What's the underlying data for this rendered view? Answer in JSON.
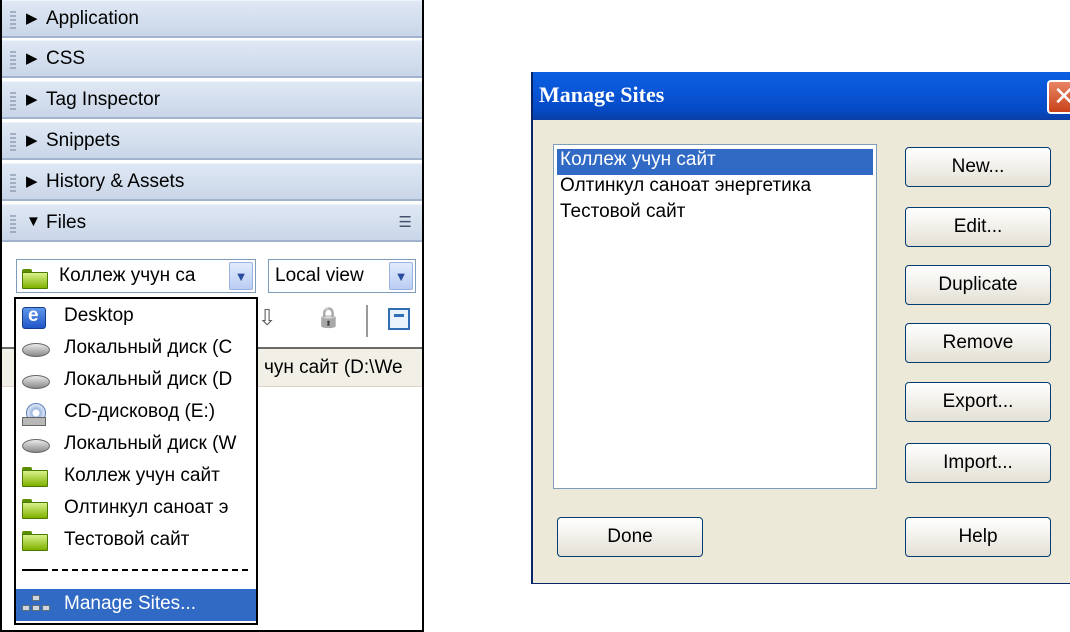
{
  "left_panel": {
    "panels": [
      {
        "label": "Application",
        "expanded": false
      },
      {
        "label": "CSS",
        "expanded": false
      },
      {
        "label": "Tag Inspector",
        "expanded": false
      },
      {
        "label": "Snippets",
        "expanded": false
      },
      {
        "label": "History & Assets",
        "expanded": false
      },
      {
        "label": "Files",
        "expanded": true
      }
    ],
    "collapsed_arrow": "▶",
    "expanded_arrow": "▼",
    "options_icon": "☰",
    "site_select": {
      "value": "Коллеж учун са",
      "arrow": "▼"
    },
    "view_select": {
      "value": "Local view",
      "arrow": "▼"
    },
    "toolbar_icons": {
      "checkin": "⇩",
      "lock": "🔒"
    },
    "path_text": "чун сайт (D:\\We",
    "dropdown": {
      "items": [
        {
          "label": "Desktop",
          "icon": "desktop-icon"
        },
        {
          "label": "Локальный диск (C",
          "icon": "disk-icon"
        },
        {
          "label": "Локальный диск (D",
          "icon": "disk-icon"
        },
        {
          "label": "CD-дисковод (E:)",
          "icon": "cd-icon"
        },
        {
          "label": "Локальный диск (W",
          "icon": "disk-icon"
        },
        {
          "label": "Коллеж учун сайт",
          "icon": "folder-icon"
        },
        {
          "label": "Олтинкул саноат э",
          "icon": "folder-icon"
        },
        {
          "label": "Тестовой сайт",
          "icon": "folder-icon"
        }
      ],
      "manage_label": "Manage Sites..."
    }
  },
  "dialog": {
    "title": "Manage Sites",
    "close_glyph": "✕",
    "sites": [
      "Коллеж учун сайт",
      "Олтинкул саноат энергетика",
      "Тестовой сайт"
    ],
    "selected_index": 0,
    "buttons": {
      "new": "New...",
      "edit": "Edit...",
      "duplicate": "Duplicate",
      "remove": "Remove",
      "export": "Export...",
      "import": "Import...",
      "done": "Done",
      "help": "Help"
    },
    "colors": {
      "title_bar": "#0a56d8",
      "selection": "#316ac5",
      "close": "#d45a32"
    }
  }
}
